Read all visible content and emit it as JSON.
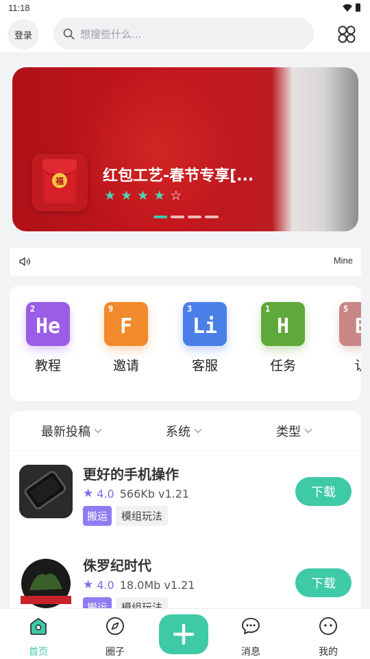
{
  "status_bar": {
    "time": "11:18"
  },
  "header": {
    "login_label": "登录",
    "search_placeholder": "想搜些什么..."
  },
  "banner": {
    "title": "红包工艺-春节专享[...",
    "icon_text": "福",
    "rating_stars": 4,
    "max_stars": 5,
    "page_count": 4,
    "active_page": 1
  },
  "notice": {
    "text": "Mine"
  },
  "categories": [
    {
      "label": "教程",
      "num": "2",
      "symbol": "He",
      "color": "#9b5de5"
    },
    {
      "label": "邀请",
      "num": "9",
      "symbol": "F",
      "color": "#f08a2c"
    },
    {
      "label": "客服",
      "num": "3",
      "symbol": "Li",
      "color": "#4a7fe8"
    },
    {
      "label": "任务",
      "num": "1",
      "symbol": "H",
      "color": "#5fa83a"
    },
    {
      "label": "认",
      "num": "5",
      "symbol": "B",
      "color": "#c98686"
    }
  ],
  "filters": [
    {
      "label": "最新投稿"
    },
    {
      "label": "系统"
    },
    {
      "label": "类型"
    }
  ],
  "items": [
    {
      "name": "更好的手机操作",
      "rating": "4.0",
      "size": "566Kb",
      "version": "v1.21",
      "tag_type": "搬运",
      "tag_category": "模组玩法",
      "button": "下载"
    },
    {
      "name": "侏罗纪时代",
      "rating": "4.0",
      "size": "18.0Mb",
      "version": "v1.21",
      "tag_type": "搬运",
      "tag_category": "模组玩法",
      "button": "下载"
    }
  ],
  "tabbar": {
    "tabs": [
      {
        "label": "首页",
        "icon": "home-icon",
        "active": true
      },
      {
        "label": "圈子",
        "icon": "compass-icon"
      },
      {
        "label": "消息",
        "icon": "chat-icon"
      },
      {
        "label": "我的",
        "icon": "face-icon"
      }
    ]
  },
  "colors": {
    "accent": "#3ec9a7",
    "rating": "#7b6cf0",
    "banner_red": "#c4161d"
  }
}
